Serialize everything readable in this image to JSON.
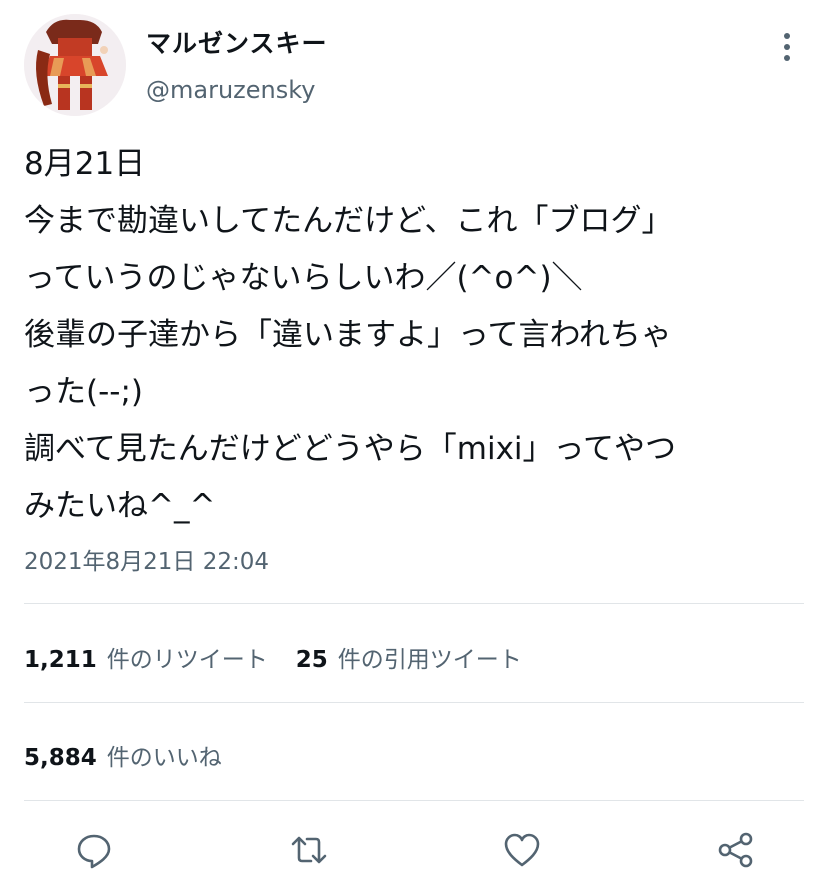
{
  "user": {
    "display_name": "マルゼンスキー",
    "handle": "@maruzensky"
  },
  "tweet": {
    "text": "8月21日\n今まで勘違いしてたんだけど、これ「ブログ」\nっていうのじゃないらしいわ／(^o^)＼\n後輩の子達から「違いますよ」って言われちゃ\nった(-‐;)\n調べて見たんだけどどうやら「mixi」ってやつ\nみたいね^_^",
    "timestamp": "2021年8月21日 22:04"
  },
  "stats": {
    "retweets_count": "1,211",
    "retweets_label": "件のリツイート",
    "quotes_count": "25",
    "quotes_label": "件の引用ツイート",
    "likes_count": "5,884",
    "likes_label": "件のいいね"
  },
  "actions": {
    "reply_icon": "reply-icon",
    "retweet_icon": "retweet-icon",
    "like_icon": "heart-icon",
    "share_icon": "share-icon"
  },
  "colors": {
    "text_primary": "#0f1419",
    "text_secondary": "#536471",
    "divider": "#e1e5e8",
    "icon": "#536471"
  }
}
